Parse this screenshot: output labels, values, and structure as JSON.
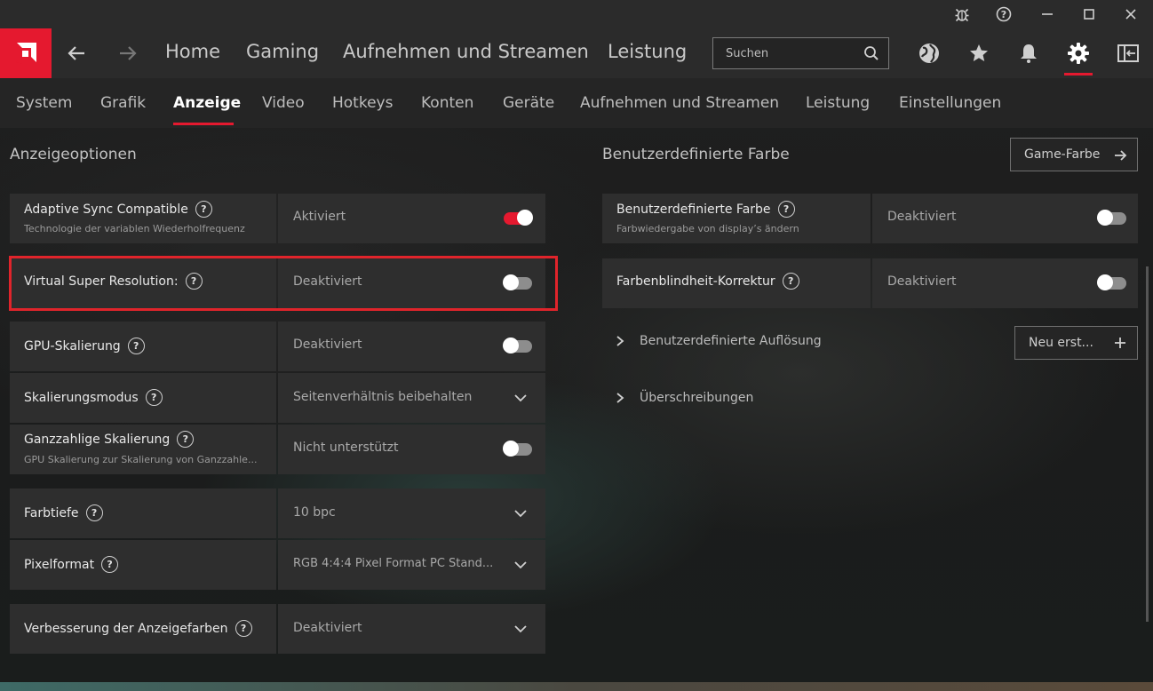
{
  "titlebar": {
    "buttons": [
      "bug-icon",
      "help-icon",
      "minimize-icon",
      "maximize-icon",
      "close-icon"
    ]
  },
  "topnav": {
    "items": [
      "Home",
      "Gaming",
      "Aufnehmen und Streamen",
      "Leistung"
    ],
    "search_placeholder": "Suchen",
    "accent": "#e5192f"
  },
  "subnav": {
    "items": [
      "System",
      "Grafik",
      "Anzeige",
      "Video",
      "Hotkeys",
      "Konten",
      "Geräte",
      "Aufnehmen und Streamen",
      "Leistung",
      "Einstellungen"
    ],
    "active": "Anzeige"
  },
  "left": {
    "title": "Anzeigeoptionen",
    "rows": [
      {
        "label": "Adaptive Sync Compatible",
        "sub": "Technologie der variablen Wiederholfrequenz",
        "value": "Aktiviert",
        "control": "toggle",
        "on": true
      },
      {
        "label": "Virtual Super Resolution:",
        "sub": "",
        "value": "Deaktiviert",
        "control": "toggle",
        "on": false
      },
      {
        "label": "GPU-Skalierung",
        "sub": "",
        "value": "Deaktiviert",
        "control": "toggle",
        "on": false
      },
      {
        "label": "Skalierungsmodus",
        "sub": "",
        "value": "Seitenverhältnis beibehalten",
        "control": "dropdown"
      },
      {
        "label": "Ganzzahlige Skalierung",
        "sub": "GPU Skalierung zur Skalierung von Ganzzahle...",
        "value": "Nicht unterstützt",
        "control": "toggle",
        "on": false
      },
      {
        "label": "Farbtiefe",
        "sub": "",
        "value": "10 bpc",
        "control": "dropdown"
      },
      {
        "label": "Pixelformat",
        "sub": "",
        "value": "RGB 4:4:4 Pixel Format PC Stand...",
        "control": "dropdown"
      },
      {
        "label": "Verbesserung der Anzeigefarben",
        "sub": "",
        "value": "Deaktiviert",
        "control": "dropdown"
      }
    ]
  },
  "right": {
    "title": "Benutzerdefinierte Farbe",
    "game_color_button": "Game-Farbe",
    "rows": [
      {
        "label": "Benutzerdefinierte Farbe",
        "sub": "Farbwiedergabe von display’s ändern",
        "value": "Deaktiviert",
        "on": false
      },
      {
        "label": "Farbenblindheit-Korrektur",
        "sub": "",
        "value": "Deaktiviert",
        "on": false
      }
    ],
    "custom_resolution": "Benutzerdefinierte Auflösung",
    "new_button": "Neu erst...",
    "overrides": "Überschreibungen"
  }
}
